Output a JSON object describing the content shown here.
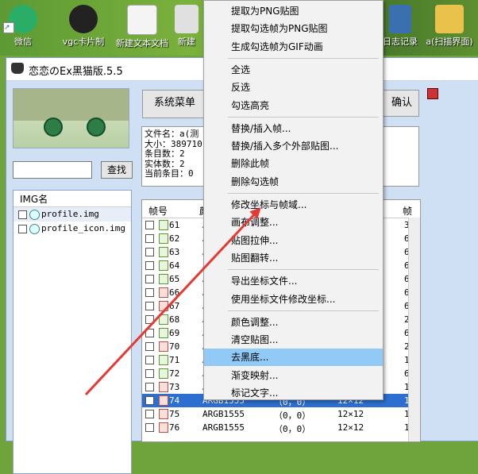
{
  "desktop": {
    "icons": [
      {
        "label": "微信",
        "color": "#2aae67"
      },
      {
        "label": "vgc卡片制",
        "color": "#ffffff"
      },
      {
        "label": "新建文本文档",
        "color": "#f4f4f4"
      },
      {
        "label": "新建",
        "color": "#e0e0e0"
      },
      {
        "label": "日志记录",
        "color": "#3a6fb0"
      },
      {
        "label": "a(扫描界面)",
        "color": "#e8c24a"
      }
    ]
  },
  "window": {
    "title": "恋恋のEx黑猫版.5.5",
    "search_button": "查找",
    "system_menu_button": "系统菜单",
    "confirm_button": "确认",
    "img_list_header": "IMG名",
    "img_files": [
      "profile.img",
      "profile_icon.img"
    ],
    "info_lines": [
      "文件名：a(测",
      "大小：389710",
      "条目数：2",
      "实体数：2",
      "当前条目：0"
    ],
    "frame_table": {
      "headers": [
        "帧号",
        "颜",
        "帧"
      ],
      "rows": [
        {
          "n": "61",
          "fmt": "A",
          "last": "3"
        },
        {
          "n": "62",
          "fmt": "A",
          "last": "6"
        },
        {
          "n": "63",
          "fmt": "A",
          "last": "6"
        },
        {
          "n": "64",
          "fmt": "A",
          "last": "6"
        },
        {
          "n": "65",
          "fmt": "A",
          "last": "6"
        },
        {
          "n": "66",
          "fmt": "A",
          "last": "6"
        },
        {
          "n": "67",
          "fmt": "A",
          "last": "6"
        },
        {
          "n": "68",
          "fmt": "A",
          "last": "2"
        },
        {
          "n": "69",
          "fmt": "A",
          "last": "6"
        },
        {
          "n": "70",
          "fmt": "A",
          "last": "2"
        },
        {
          "n": "71",
          "fmt": "A",
          "last": "1"
        },
        {
          "n": "72",
          "fmt": "A",
          "last": "6"
        },
        {
          "n": "73",
          "fmt": "A",
          "last": "1"
        },
        {
          "n": "74",
          "fmt": "ARGB1555",
          "coord": "（0，0）",
          "size": "12×12",
          "last": "1"
        },
        {
          "n": "75",
          "fmt": "ARGB1555",
          "coord": "（0，0）",
          "size": "12×12",
          "last": "1"
        },
        {
          "n": "76",
          "fmt": "ARGB1555",
          "coord": "（0，0）",
          "size": "12×12",
          "last": "1"
        }
      ]
    }
  },
  "context_menu": {
    "groups": [
      [
        "提取为PNG贴图",
        "提取勾选帧为PNG贴图",
        "生成勾选帧为GIF动画"
      ],
      [
        "全选",
        "反选",
        "勾选高亮"
      ],
      [
        "替换/插入帧...",
        "替换/插入多个外部贴图...",
        "删除此帧",
        "删除勾选帧"
      ],
      [
        "修改坐标与帧域...",
        "画布调整...",
        "贴图拉伸...",
        "贴图翻转..."
      ],
      [
        "导出坐标文件...",
        "使用坐标文件修改坐标..."
      ],
      [
        "颜色调整...",
        "清空贴图...",
        "去黑底...",
        "渐变映射...",
        "标记文字..."
      ]
    ],
    "highlighted": "去黑底..."
  },
  "colors": {
    "arrow": "#e53935",
    "menu_highlight": "#91c9f7",
    "selection": "#2d6fd0"
  }
}
